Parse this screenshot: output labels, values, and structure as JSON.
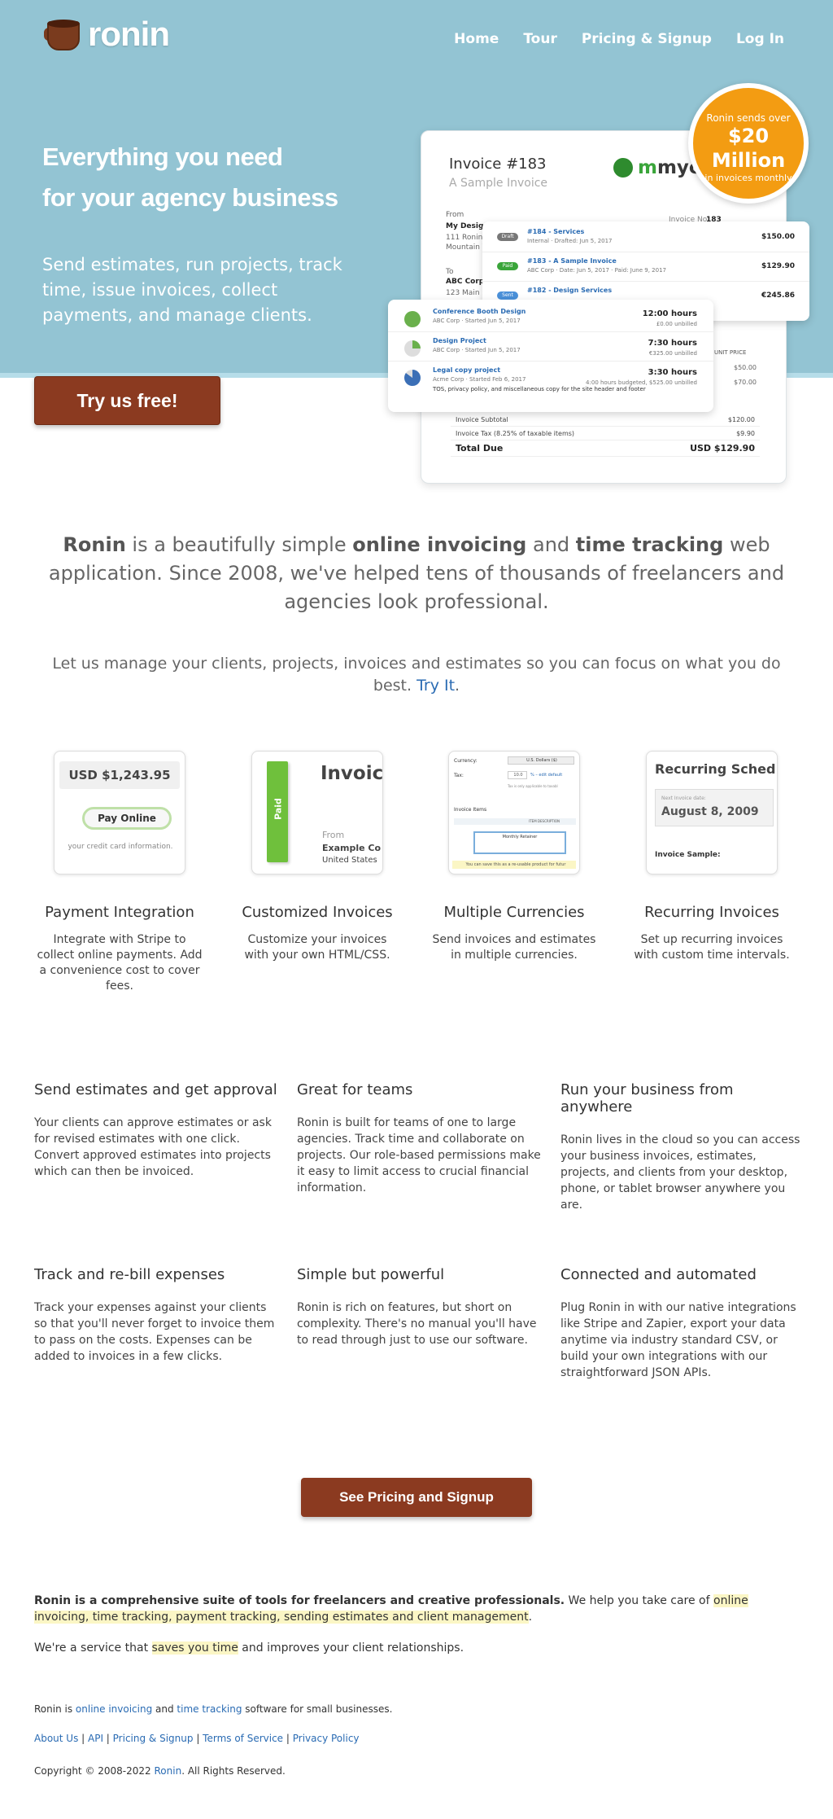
{
  "header": {
    "logo_text": "ronin",
    "nav": [
      "Home",
      "Tour",
      "Pricing & Signup",
      "Log In"
    ]
  },
  "hero": {
    "title_line1": "Everything you need",
    "title_line2": "for your agency business",
    "subtitle": "Send estimates, run projects, track time, issue invoices, collect payments, and manage clients.",
    "cta": "Try us free!"
  },
  "badge": {
    "line1": "Ronin sends over",
    "line2": "$20",
    "line3": "Million",
    "line4": "in invoices monthly"
  },
  "invoice_mock": {
    "title": "Invoice #183",
    "subtitle": "A Sample Invoice",
    "company": "myco",
    "company_highlight": "m",
    "invoice_no_label": "Invoice No.",
    "invoice_no": "183",
    "from_label": "From",
    "from_name": "My Design",
    "from_addr1": "111 Ronin D",
    "from_addr2": "Mountain V",
    "to_label": "To",
    "to_name": "ABC Corp",
    "to_addr": "123 Main St",
    "unit_price_label": "UNIT PRICE",
    "line_prices": [
      "$50.00",
      "$70.00"
    ],
    "subtotal_label": "Invoice Subtotal",
    "subtotal": "$120.00",
    "tax_label": "Invoice Tax (8.25% of taxable items)",
    "tax": "$9.90",
    "total_label": "Total Due",
    "total": "USD $129.90"
  },
  "invoice_panel": [
    {
      "tag": "Draft",
      "color": "#777777",
      "title": "#184 - Services",
      "meta": "Internal · Drafted: Jun 5, 2017",
      "amount": "$150.00"
    },
    {
      "tag": "Paid",
      "color": "#3aa53a",
      "title": "#183 - A Sample Invoice",
      "meta": "ABC Corp · Date: Jun 5, 2017 · Paid: June 9, 2017",
      "amount": "$129.90"
    },
    {
      "tag": "Sent",
      "color": "#4a90d9",
      "title": "#182 - Design Services",
      "meta": "",
      "amount": "€245.86"
    }
  ],
  "project_panel": [
    {
      "color": "#6ab04c",
      "title": "Conference Booth Design",
      "meta": "ABC Corp · Started Jun 5, 2017",
      "hours": "12:00 hours",
      "unbilled": "£0.00 unbilled",
      "note": ""
    },
    {
      "color": "#dddddd",
      "title": "Design Project",
      "meta": "ABC Corp · Started Jun 5, 2017",
      "hours": "7:30 hours",
      "unbilled": "€325.00 unbilled",
      "note": ""
    },
    {
      "color": "#3b6fb6",
      "title": "Legal copy project",
      "meta": "Acme Corp · Started Feb 6, 2017",
      "hours": "3:30 hours",
      "unbilled": "4:00 hours budgeted, $525.00 unbilled",
      "note": "TOS, privacy policy, and miscellaneous copy for the site header and footer"
    }
  ],
  "intro": {
    "brand": "Ronin",
    "p1": " is a beautifully simple ",
    "b2": "online invoicing",
    "p2": " and ",
    "b3": "time tracking",
    "p3": " web application. Since 2008, we've helped tens of thousands of freelancers and agencies look professional.",
    "manage": "Let us manage your clients, projects, invoices and estimates so you can focus on what you do best. ",
    "manage_link": "Try It",
    "manage_end": "."
  },
  "thumbs": {
    "payment_amount": "USD $1,243.95",
    "pay_online": "Pay Online",
    "card_info": "your credit card information.",
    "paid_tag": "Paid",
    "invoice_word": "Invoic",
    "from_word": "From",
    "example_co": "Example Co",
    "united_states": "United States",
    "currency_label": "Currency:",
    "currency_value": "U.S. Dollars ($)",
    "tax_label": "Tax:",
    "tax_value": "10.0",
    "tax_suffix": "% – edit default",
    "tax_note": "Tax is only applicable to taxabl",
    "invoice_items": "Invoice Items",
    "item_desc": "ITEM DESCRIPTION",
    "monthly_retainer": "Monthly Retainer",
    "reusable_note": "You can save this as a re-usable product for futur",
    "recurring_title": "Recurring Sched",
    "next_label": "Next Invoice date:",
    "next_date": "August 8, 2009",
    "invoice_sample": "Invoice Sample:"
  },
  "features": [
    {
      "title": "Payment Integration",
      "desc": "Integrate with Stripe to collect online payments. Add a convenience cost to cover fees."
    },
    {
      "title": "Customized Invoices",
      "desc": "Customize your invoices with your own HTML/CSS."
    },
    {
      "title": "Multiple Currencies",
      "desc": "Send invoices and estimates in multiple currencies."
    },
    {
      "title": "Recurring Invoices",
      "desc": "Set up recurring invoices with custom time intervals."
    }
  ],
  "grid": [
    {
      "title": "Send estimates and get approval",
      "desc": "Your clients can approve estimates or ask for revised estimates with one click. Convert approved estimates into projects which can then be invoiced."
    },
    {
      "title": "Great for teams",
      "desc": "Ronin is built for teams of one to large agencies. Track time and collaborate on projects. Our role-based permissions make it easy to limit access to crucial financial information."
    },
    {
      "title": "Run your business from anywhere",
      "desc": "Ronin lives in the cloud so you can access your business invoices, estimates, projects, and clients from your desktop, phone, or tablet browser anywhere you are."
    },
    {
      "title": "Track and re-bill expenses",
      "desc": "Track your expenses against your clients so that you'll never forget to invoice them to pass on the costs. Expenses can be added to invoices in a few clicks."
    },
    {
      "title": "Simple but powerful",
      "desc": "Ronin is rich on features, but short on complexity. There's no manual you'll have to read through just to use our software."
    },
    {
      "title": "Connected and automated",
      "desc": "Plug Ronin in with our native integrations like Stripe and Zapier, export your data anytime via industry standard CSV, or build your own integrations with our straightforward JSON APIs."
    }
  ],
  "pricing_cta": "See Pricing and Signup",
  "about": {
    "bold": "Ronin is a comprehensive suite of tools for freelancers and creative professionals.",
    "mid": " We help you take care of ",
    "hl": "online invoicing, time tracking, payment tracking, sending estimates and client management",
    "end": ".",
    "s2a": "We're a service that ",
    "s2hl": "saves you time",
    "s2b": " and improves your client relationships."
  },
  "footer": {
    "l1a": "Ronin is ",
    "l1link1": "online invoicing",
    "l1b": " and ",
    "l1link2": "time tracking",
    "l1c": " software for small businesses.",
    "links": [
      "About Us",
      "API",
      "Pricing & Signup",
      "Terms of Service",
      "Privacy Policy"
    ],
    "sep": " | ",
    "copy_a": "Copyright © 2008-2022 ",
    "copy_link": "Ronin",
    "copy_b": ". All Rights Reserved."
  }
}
